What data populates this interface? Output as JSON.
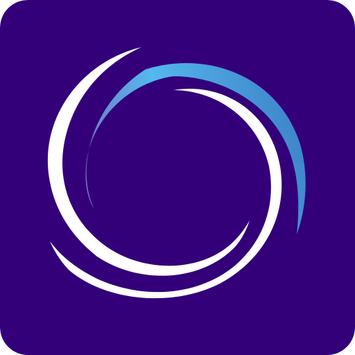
{
  "icon": {
    "name": "swirl-logo-icon",
    "colors": {
      "background": "#33007a",
      "swirl_primary": "#ffffff",
      "swirl_accent_start": "#7b66b8",
      "swirl_accent_mid": "#55b8ee",
      "swirl_accent_end": "#3d84c8"
    }
  }
}
